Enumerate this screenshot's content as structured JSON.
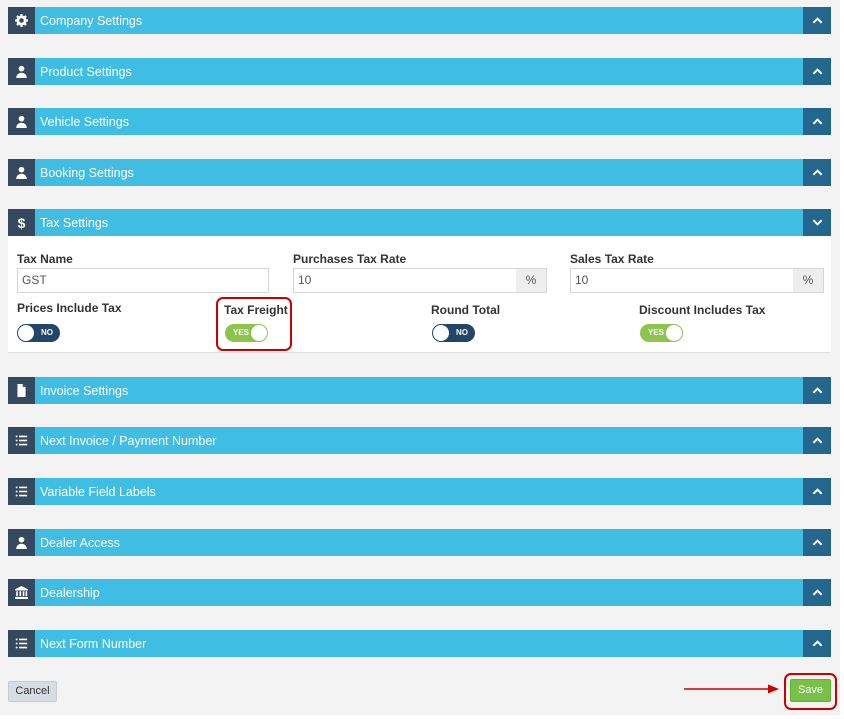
{
  "panels": {
    "company": "Company Settings",
    "product": "Product Settings",
    "vehicle": "Vehicle Settings",
    "booking": "Booking Settings",
    "tax": "Tax Settings",
    "invoice": "Invoice Settings",
    "next_invoice": "Next Invoice / Payment Number",
    "variable_fields": "Variable Field Labels",
    "dealer_access": "Dealer Access",
    "dealership": "Dealership",
    "next_form": "Next Form Number"
  },
  "tax": {
    "tax_name_label": "Tax Name",
    "tax_name_value": "GST",
    "purchases_label": "Purchases Tax Rate",
    "purchases_value": "10",
    "sales_label": "Sales Tax Rate",
    "sales_value": "10",
    "percent": "%",
    "prices_include_label": "Prices Include Tax",
    "prices_include_value": "NO",
    "tax_freight_label": "Tax Freight",
    "tax_freight_value": "YES",
    "round_total_label": "Round Total",
    "round_total_value": "NO",
    "discount_label": "Discount Includes Tax",
    "discount_value": "YES"
  },
  "footer": {
    "cancel_label": "Cancel",
    "save_label": "Save"
  },
  "colors": {
    "panel_header": "#40bde3",
    "panel_icon": "#34495e",
    "panel_toggle": "#23678e",
    "toggle_off": "#23456a",
    "toggle_on": "#8dc44e",
    "save": "#78c147",
    "highlight": "#cc0000"
  }
}
